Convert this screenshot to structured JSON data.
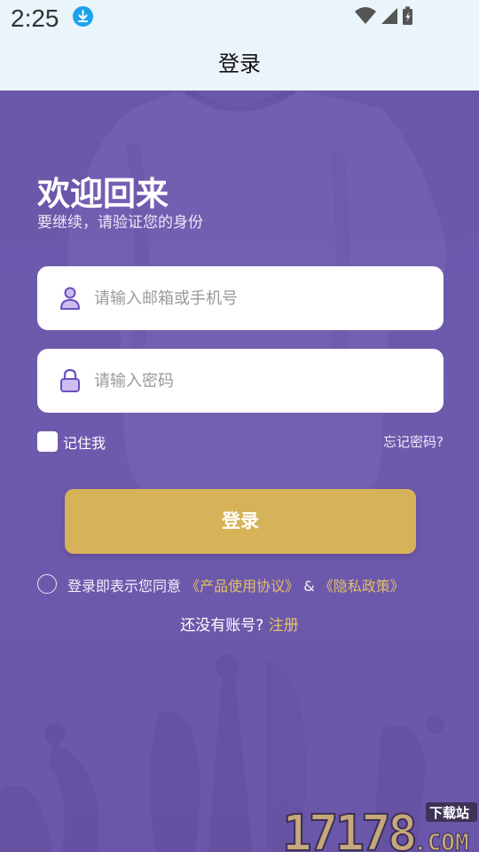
{
  "status_bar": {
    "time": "2:25"
  },
  "app_bar": {
    "title": "登录"
  },
  "welcome": {
    "title": "欢迎回来",
    "subtitle": "要继续，请验证您的身份"
  },
  "form": {
    "account_placeholder": "请输入邮箱或手机号",
    "password_placeholder": "请输入密码",
    "remember_label": "记住我",
    "forgot_label": "忘记密码?",
    "login_label": "登录"
  },
  "agreement": {
    "prefix": "登录即表示您同意",
    "terms": "《产品使用协议》",
    "amp": " & ",
    "privacy": "《隐私政策》"
  },
  "register": {
    "prefix": "还没有账号? ",
    "link": "注册"
  },
  "watermark": {
    "digits": "17178",
    "site": "下载站",
    "domain": ".COM"
  },
  "colors": {
    "accent_gold": "#d6b358",
    "background_purple": "#6a56a8",
    "status_bar_bg": "#eaf4fb"
  }
}
